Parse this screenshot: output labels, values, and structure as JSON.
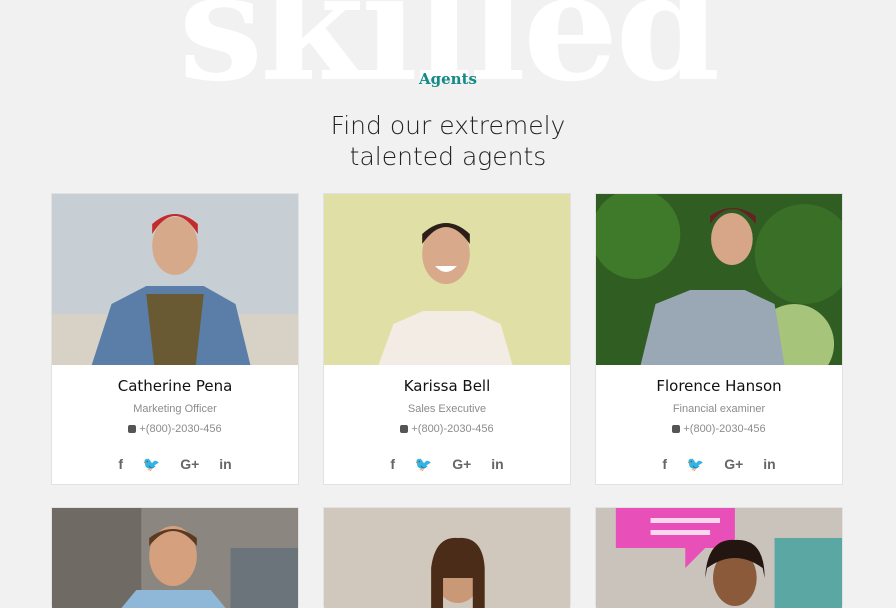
{
  "hero": {
    "bg_word": "skilled",
    "subheading": "Agents",
    "heading_line1": "Find our extremely",
    "heading_line2": "talented agents"
  },
  "agents": [
    {
      "name": "Catherine Pena",
      "position": "Marketing Officer",
      "phone": "+(800)-2030-456"
    },
    {
      "name": "Karissa Bell",
      "position": "Sales Executive",
      "phone": "+(800)-2030-456"
    },
    {
      "name": "Florence Hanson",
      "position": "Financial examiner",
      "phone": "+(800)-2030-456"
    }
  ],
  "social_icons": [
    "facebook-icon",
    "twitter-icon",
    "google-plus-icon",
    "linkedin-icon"
  ],
  "colors": {
    "accent": "#138a86",
    "background": "#f1f1f1"
  }
}
